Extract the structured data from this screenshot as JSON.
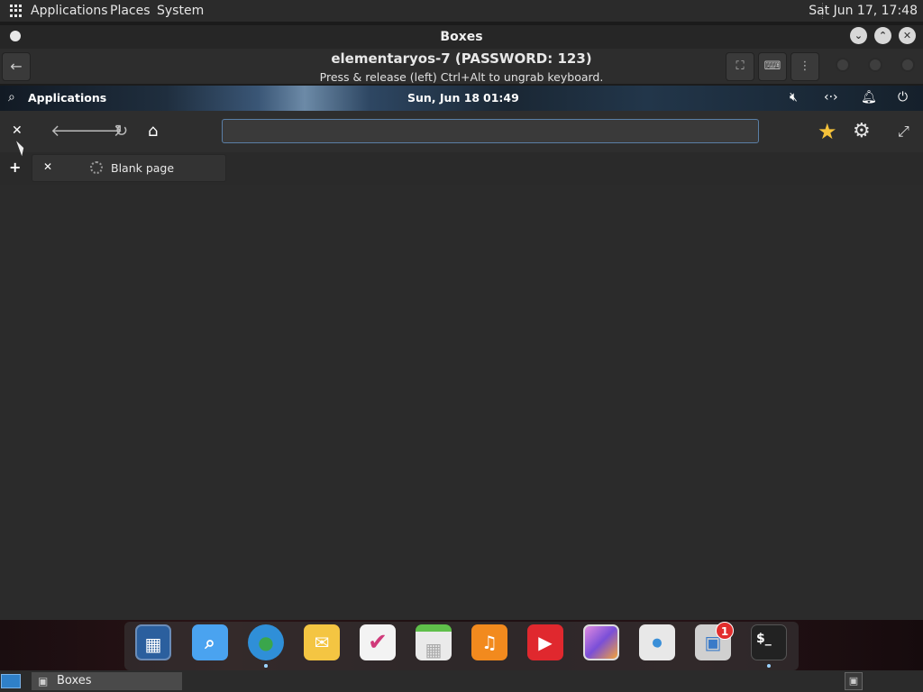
{
  "host_panel": {
    "menus": [
      "Applications",
      "Places",
      "System"
    ],
    "clock": "Sat Jun 17, 17:48"
  },
  "window": {
    "title": "Boxes"
  },
  "boxes_header": {
    "vm_title": "elementaryos-7 (PASSWORD: 123)",
    "hint": "Press & release (left) Ctrl+Alt to ungrab keyboard."
  },
  "guest_panel": {
    "applications": "Applications",
    "date": "Sun, Jun 18",
    "time": "01:49"
  },
  "browser": {
    "url_value": "",
    "tab_label": "Blank page"
  },
  "dock": {
    "apps": [
      "Multitasking View",
      "Files",
      "Web",
      "Mail",
      "Tasks",
      "Calendar",
      "Music",
      "Videos",
      "Photos",
      "System Settings",
      "AppCenter",
      "Terminal"
    ],
    "appcenter_badge": "1",
    "colors": {
      "web": "#3aa64b",
      "music": "#f28a1e",
      "videos": "#e0282e",
      "mail": "#f4c542"
    }
  },
  "host_taskbar": {
    "task_label": "Boxes"
  }
}
